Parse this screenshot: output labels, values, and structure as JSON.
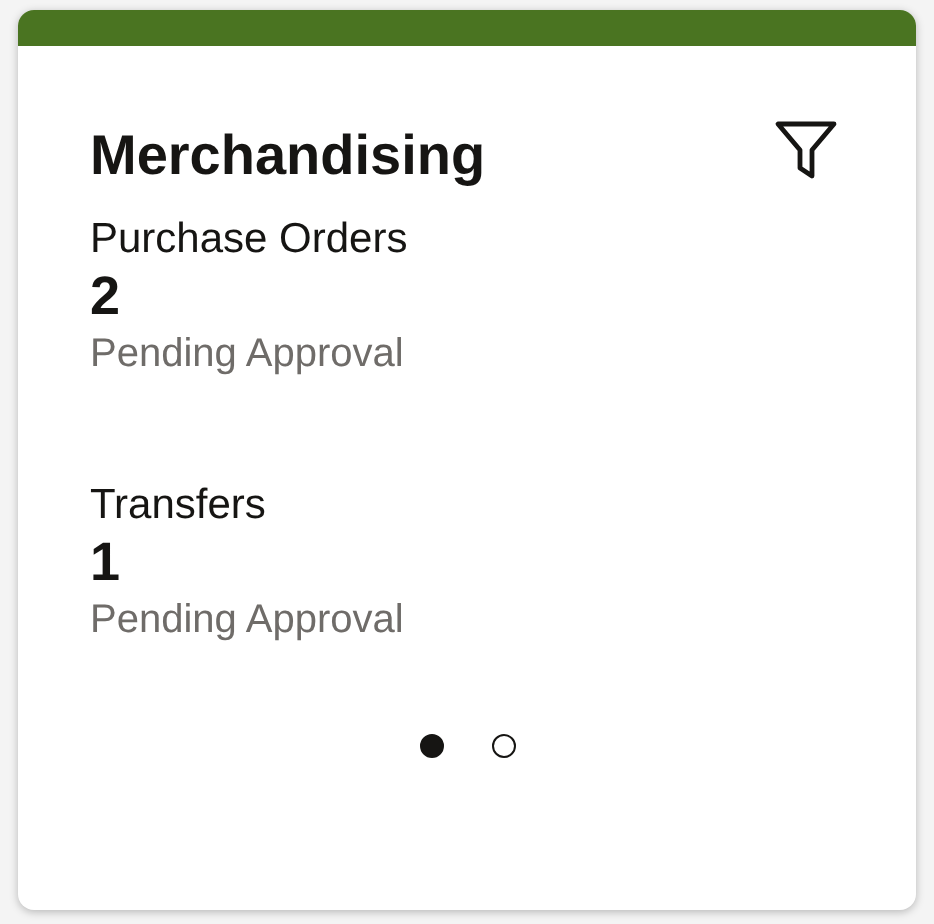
{
  "card": {
    "title": "Merchandising",
    "items": [
      {
        "label": "Purchase Orders",
        "count": "2",
        "status": "Pending Approval"
      },
      {
        "label": "Transfers",
        "count": "1",
        "status": "Pending Approval"
      }
    ],
    "pages": [
      {
        "selected": true
      },
      {
        "selected": false
      }
    ]
  }
}
